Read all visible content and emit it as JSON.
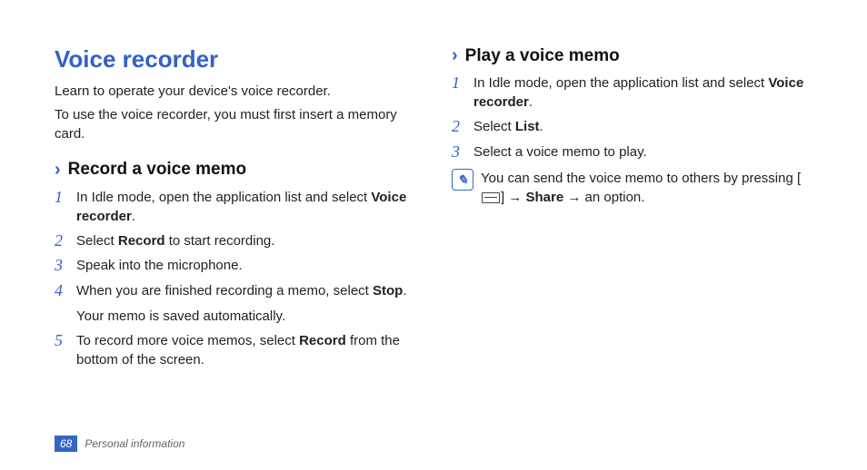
{
  "title": "Voice recorder",
  "intro1": "Learn to operate your device's voice recorder.",
  "intro2": "To use the voice recorder, you must first insert a memory card.",
  "left": {
    "heading": "Record a voice memo",
    "s1a": "In Idle mode, open the application list and select ",
    "s1b": "Voice recorder",
    "s1c": ".",
    "s2a": "Select ",
    "s2b": "Record",
    "s2c": " to start recording.",
    "s3": "Speak into the microphone.",
    "s4a": "When you are finished recording a memo, select ",
    "s4b": "Stop",
    "s4c": ".",
    "s4sub": "Your memo is saved automatically.",
    "s5a": "To record more voice memos, select ",
    "s5b": "Record",
    "s5c": " from the bottom of the screen."
  },
  "right": {
    "heading": "Play a voice memo",
    "s1a": "In Idle mode, open the application list and select ",
    "s1b": "Voice recorder",
    "s1c": ".",
    "s2a": "Select ",
    "s2b": "List",
    "s2c": ".",
    "s3": "Select a voice memo to play.",
    "note_a": "You can send the voice memo to others by pressing [",
    "note_b": "] → ",
    "note_bold": "Share",
    "note_c": " → an option."
  },
  "nums": {
    "n1": "1",
    "n2": "2",
    "n3": "3",
    "n4": "4",
    "n5": "5"
  },
  "footer": {
    "page": "68",
    "section": "Personal information"
  }
}
